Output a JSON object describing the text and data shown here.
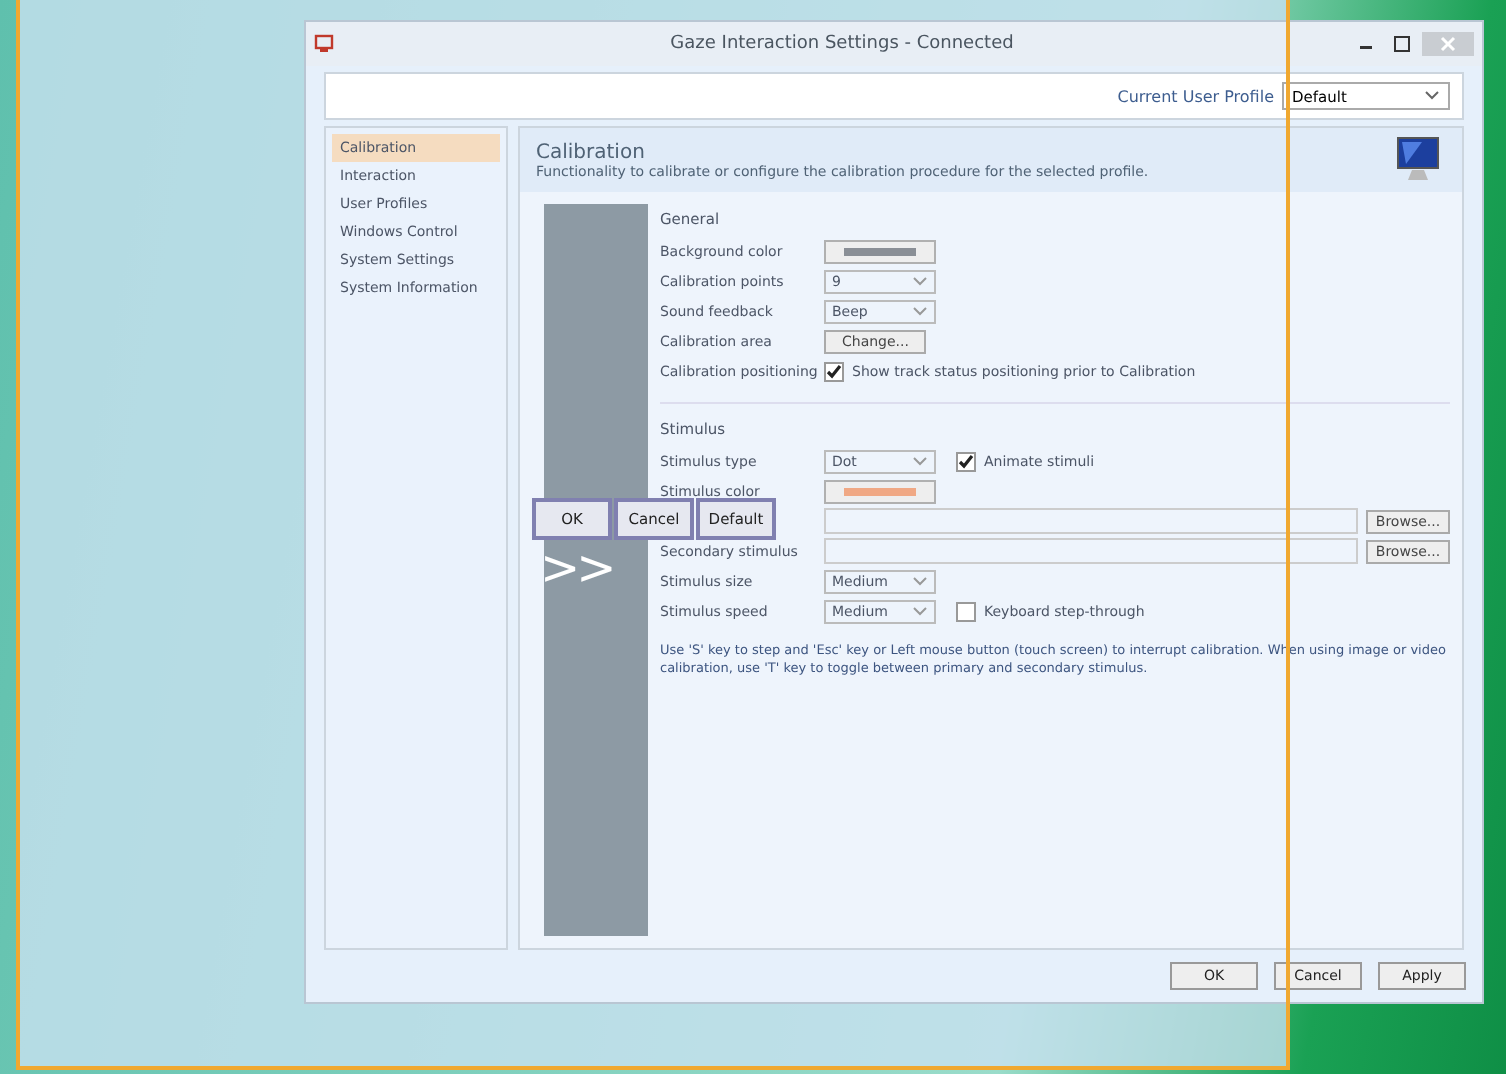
{
  "window": {
    "title": "Gaze Interaction Settings - Connected"
  },
  "profile": {
    "label": "Current User Profile",
    "value": "Default"
  },
  "sidebar": {
    "items": [
      {
        "label": "Calibration",
        "selected": true
      },
      {
        "label": "Interaction",
        "selected": false
      },
      {
        "label": "User Profiles",
        "selected": false
      },
      {
        "label": "Windows Control",
        "selected": false
      },
      {
        "label": "System Settings",
        "selected": false
      },
      {
        "label": "System Information",
        "selected": false
      }
    ]
  },
  "header": {
    "title": "Calibration",
    "description": "Functionality to calibrate or configure the calibration procedure for the selected profile."
  },
  "general": {
    "title": "General",
    "rows": [
      {
        "kind": "color",
        "label": "Background color",
        "color": "#8a8f96"
      },
      {
        "kind": "select",
        "label": "Calibration points",
        "value": "9"
      },
      {
        "kind": "select",
        "label": "Sound feedback",
        "value": "Beep"
      },
      {
        "kind": "button",
        "label": "Calibration area",
        "value": "Change..."
      },
      {
        "kind": "check",
        "label": "Calibration positioning",
        "text": "Show track status positioning prior to Calibration",
        "checked": true
      }
    ]
  },
  "stimulus": {
    "title": "Stimulus",
    "rows": [
      {
        "kind": "select",
        "label": "Stimulus type",
        "value": "Dot",
        "check": {
          "text": "Animate stimuli",
          "checked": true
        }
      },
      {
        "kind": "color",
        "label": "Stimulus color",
        "color": "#f0a884"
      },
      {
        "kind": "file",
        "button": "Browse..."
      },
      {
        "kind": "file",
        "label": "Secondary stimulus",
        "button": "Browse..."
      },
      {
        "kind": "select",
        "label": "Stimulus size",
        "value": "Medium"
      },
      {
        "kind": "select",
        "label": "Stimulus speed",
        "value": "Medium",
        "check": {
          "text": "Keyboard step-through",
          "checked": false
        }
      }
    ],
    "note": "Use 'S' key to step and 'Esc' key or Left mouse button (touch screen) to interrupt calibration. When using image or video calibration, use 'T' key to toggle between primary and secondary stimulus."
  },
  "footer": {
    "buttons": [
      "OK",
      "Cancel",
      "Apply"
    ]
  },
  "overlay": {
    "buttons": [
      "OK",
      "Cancel",
      "Default"
    ],
    "arrow": ">>"
  }
}
